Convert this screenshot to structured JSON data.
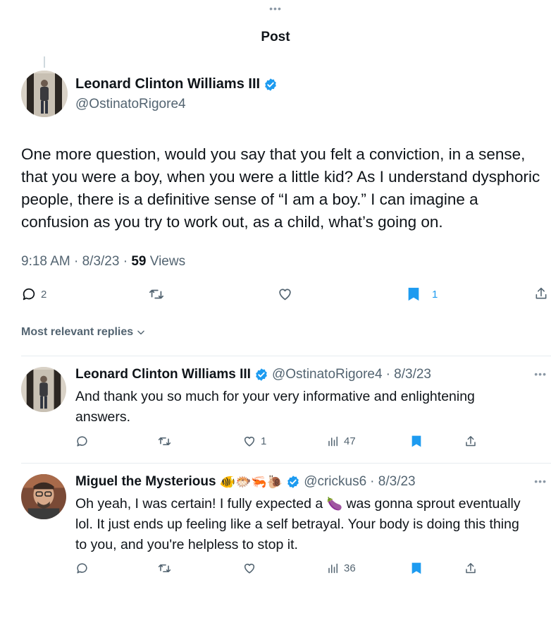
{
  "header": {
    "dots": "•••",
    "title": "Post"
  },
  "post": {
    "author_name": "Leonard Clinton Williams III",
    "handle": "@OstinatoRigore4",
    "text": "One more question, would you say that you felt a conviction, in a sense, that you were a boy, when you were a little kid? As I understand dysphoric people, there is a definitive sense of “I am a boy.” I can imagine a confusion as you try to work out, as a child, what’s going on.",
    "time": "9:18 AM",
    "date": "8/3/23",
    "views": "59",
    "views_label": "Views",
    "sep": " · ",
    "replies": "2",
    "bookmarks": "1",
    "icons": [
      "reply-icon",
      "retweet-icon",
      "like-icon",
      "bookmark-icon",
      "share-icon"
    ]
  },
  "replies_filter": {
    "label": "Most relevant replies"
  },
  "replies": [
    {
      "name": "Leonard Clinton Williams III",
      "handle": "@OstinatoRigore4",
      "date": "· 8/3/23",
      "text": "And thank you so much for your very informative and enlightening answers.",
      "likes": "1",
      "views": "47",
      "more": "•••"
    },
    {
      "name": "Miguel the Mysterious",
      "name_emojis": "🐠🐡🦐🐌",
      "handle": "@crickus6",
      "date": "· 8/3/23",
      "text_before": "Oh yeah, I was certain! I fully expected a ",
      "text_emoji": "🍆",
      "text_after": " was gonna sprout eventually lol. It just ends up feeling like a self betrayal. Your body is doing this thing to you, and you're helpless to stop it.",
      "views": "36",
      "more": "•••"
    }
  ],
  "colors": {
    "accent": "#1d9bf0",
    "muted": "#536471",
    "text": "#0f1419",
    "divider": "#e6ecf0"
  }
}
